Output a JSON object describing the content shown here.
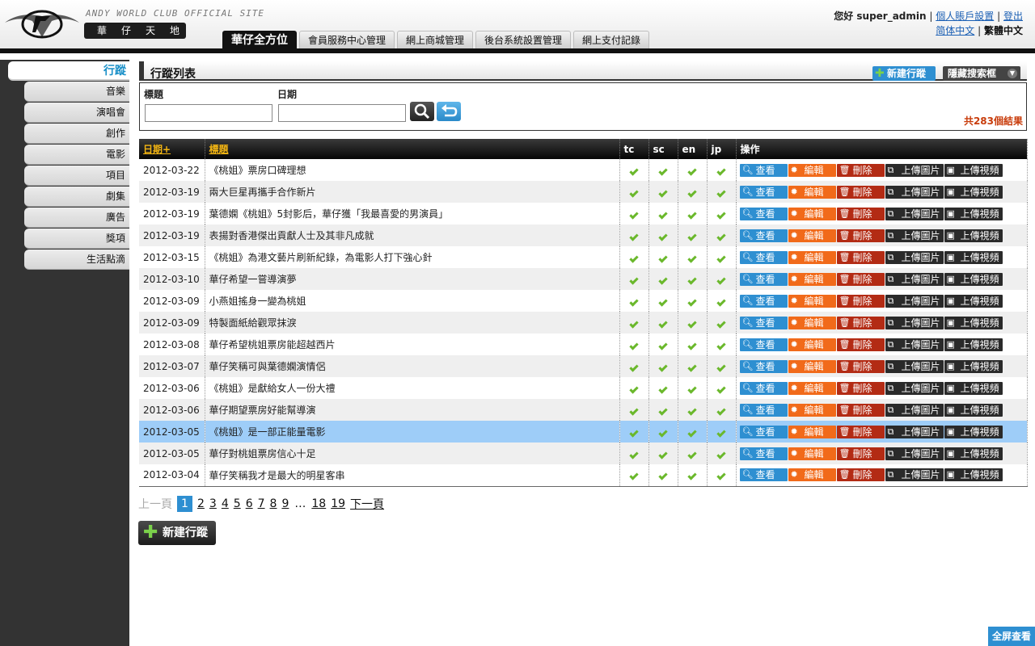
{
  "header": {
    "logo_text": "ANDY WORLD CLUB OFFICIAL SITE",
    "logo_sub": "華仔天地",
    "nav_tabs": [
      "華仔全方位",
      "會員服務中心管理",
      "網上商城管理",
      "後台系統設置管理",
      "網上支付記錄"
    ],
    "greeting": "您好 super_admin",
    "account_settings": "個人賬戶設置",
    "logout": "登出",
    "lang_simplified": "简体中文",
    "lang_traditional": "繁體中文"
  },
  "sidebar": {
    "main": "行蹤",
    "items": [
      "音樂",
      "演唱會",
      "創作",
      "電影",
      "項目",
      "劇集",
      "廣告",
      "獎項",
      "生活點滴"
    ]
  },
  "list": {
    "title": "行蹤列表",
    "new_button": "新建行蹤",
    "hide_search": "隱藏搜索框",
    "search_title_label": "標題",
    "search_date_label": "日期",
    "search_title_value": "",
    "search_date_value": "",
    "result_count": "共283個結果"
  },
  "table": {
    "headers": {
      "date": "日期+",
      "title": "標題",
      "tc": "tc",
      "sc": "sc",
      "en": "en",
      "jp": "jp",
      "ops": "操作"
    },
    "op_labels": {
      "view": "查看",
      "edit": "編輯",
      "delete": "刪除",
      "upload_img": "上傳圖片",
      "upload_video": "上傳視頻"
    },
    "selected_row": 12,
    "rows": [
      {
        "date": "2012-03-22",
        "title": "《桃姐》票房口碑理想"
      },
      {
        "date": "2012-03-19",
        "title": "兩大巨星再攜手合作新片"
      },
      {
        "date": "2012-03-19",
        "title": "葉德嫻《桃姐》5封影后，華仔獲「我最喜愛的男演員」"
      },
      {
        "date": "2012-03-19",
        "title": "表揚對香港傑出貢獻人士及其非凡成就"
      },
      {
        "date": "2012-03-15",
        "title": "《桃姐》為港文藝片刷新紀錄，為電影人打下強心針"
      },
      {
        "date": "2012-03-10",
        "title": "華仔希望一嘗導演夢"
      },
      {
        "date": "2012-03-09",
        "title": "小燕姐搖身一變為桃姐"
      },
      {
        "date": "2012-03-09",
        "title": "特製面紙給觀眾抹淚"
      },
      {
        "date": "2012-03-08",
        "title": "華仔希望桃姐票房能超越西片"
      },
      {
        "date": "2012-03-07",
        "title": "華仔笑稱可與葉德嫻演情侶"
      },
      {
        "date": "2012-03-06",
        "title": "《桃姐》是獻給女人一份大禮"
      },
      {
        "date": "2012-03-06",
        "title": "華仔期望票房好能幫導演"
      },
      {
        "date": "2012-03-05",
        "title": "《桃姐》是一部正能量電影"
      },
      {
        "date": "2012-03-05",
        "title": "華仔對桃姐票房信心十足"
      },
      {
        "date": "2012-03-04",
        "title": "華仔笑稱我才是最大的明星客串"
      }
    ]
  },
  "pagination": {
    "prev": "上一頁",
    "current": "1",
    "pages": [
      "2",
      "3",
      "4",
      "5",
      "6",
      "7",
      "8",
      "9"
    ],
    "ellipsis": "…",
    "tail_pages": [
      "18",
      "19"
    ],
    "next": "下一頁"
  },
  "bottom_new_button": "新建行蹤",
  "fullscreen_button": "全屏查看",
  "colors": {
    "accent": "#2e8fd1",
    "edit": "#f16a1a",
    "delete": "#b32b14",
    "count": "#c83c0b",
    "check": "#6ab82b",
    "selected": "#9ecdf8"
  }
}
